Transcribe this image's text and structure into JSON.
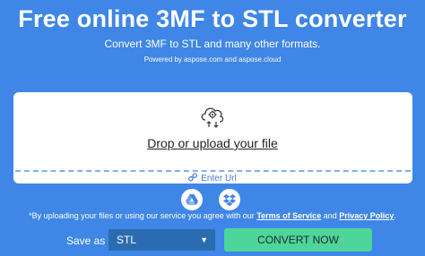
{
  "header": {
    "title": "Free online 3MF to STL converter",
    "subtitle": "Convert 3MF to STL and many other formats.",
    "powered_prefix": "Powered by",
    "powered_link1": "aspose.com",
    "powered_and": "and",
    "powered_link2": "aspose.cloud"
  },
  "upload": {
    "drop_label": "Drop or upload your file",
    "enter_url": "Enter Url",
    "icon": "cloud-upload-gear-icon"
  },
  "cloud_sources": [
    {
      "icon": "google-drive-icon"
    },
    {
      "icon": "dropbox-icon"
    }
  ],
  "consent": {
    "prefix": "*By uploading your files or using our service you agree with our",
    "terms": "Terms of Service",
    "and": "and",
    "privacy": "Privacy Policy",
    "suffix": "."
  },
  "conversion": {
    "save_as_label": "Save as",
    "format_value": "STL",
    "convert_label": "CONVERT NOW"
  },
  "colors": {
    "background": "#3f86e6",
    "convert_button": "#4dd59a",
    "select": "#2b6cb0"
  }
}
